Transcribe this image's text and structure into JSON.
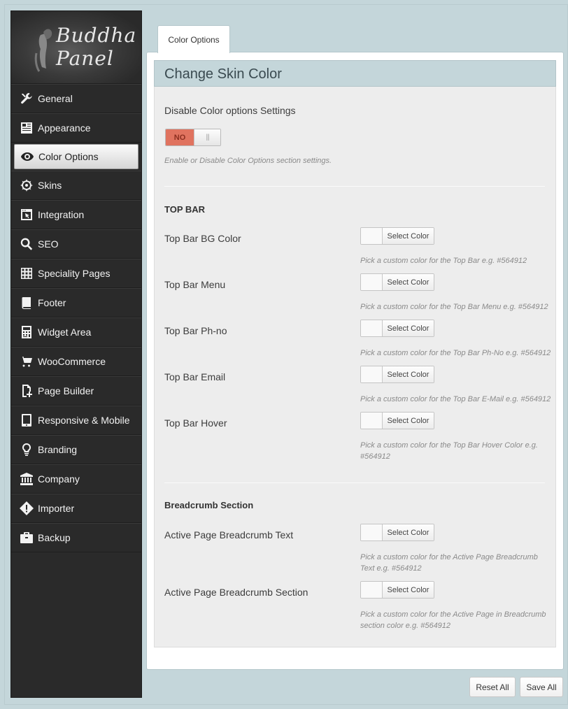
{
  "logo": {
    "line1": "Buddha",
    "line2": "Panel"
  },
  "sidebar": {
    "items": [
      {
        "label": "General",
        "icon": "wrench-icon"
      },
      {
        "label": "Appearance",
        "icon": "newspaper-icon"
      },
      {
        "label": "Color Options",
        "icon": "eye-icon",
        "active": true
      },
      {
        "label": "Skins",
        "icon": "ship-wheel-icon"
      },
      {
        "label": "Integration",
        "icon": "browser-cursor-icon"
      },
      {
        "label": "SEO",
        "icon": "magnifier-icon"
      },
      {
        "label": "Speciality Pages",
        "icon": "grid-icon"
      },
      {
        "label": "Footer",
        "icon": "book-icon"
      },
      {
        "label": "Widget Area",
        "icon": "calculator-icon"
      },
      {
        "label": "WooCommerce",
        "icon": "cart-icon"
      },
      {
        "label": "Page Builder",
        "icon": "file-plus-icon"
      },
      {
        "label": "Responsive & Mobile",
        "icon": "tablet-icon"
      },
      {
        "label": "Branding",
        "icon": "bulb-icon"
      },
      {
        "label": "Company",
        "icon": "bank-icon"
      },
      {
        "label": "Importer",
        "icon": "warning-diamond-icon"
      },
      {
        "label": "Backup",
        "icon": "briefcase-icon"
      }
    ]
  },
  "tab": {
    "label": "Color Options"
  },
  "section": {
    "title": "Change Skin Color"
  },
  "disable": {
    "label": "Disable Color options Settings",
    "toggle_value": "NO",
    "toggle_knob": "|||",
    "desc": "Enable or Disable Color Options section settings."
  },
  "top_bar": {
    "heading": "TOP BAR",
    "fields": [
      {
        "label": "Top Bar BG Color",
        "button": "Select Color",
        "desc": "Pick a custom color for the Top Bar e.g. #564912"
      },
      {
        "label": "Top Bar Menu",
        "button": "Select Color",
        "desc": "Pick a custom color for the Top Bar Menu e.g. #564912"
      },
      {
        "label": "Top Bar Ph-no",
        "button": "Select Color",
        "desc": "Pick a custom color for the Top Bar Ph-No e.g. #564912"
      },
      {
        "label": "Top Bar Email",
        "button": "Select Color",
        "desc": "Pick a custom color for the Top Bar E-Mail e.g. #564912"
      },
      {
        "label": "Top Bar Hover",
        "button": "Select Color",
        "desc1": "Pick a custom color for the Top Bar Hover Color e.g.",
        "desc2": "#564912"
      }
    ]
  },
  "breadcrumb": {
    "heading": "Breadcrumb Section",
    "fields": [
      {
        "label": "Active Page Breadcrumb Text",
        "button": "Select Color",
        "desc1": "Pick a custom color for the Active Page Breadcrumb",
        "desc2": "Text e.g. #564912"
      },
      {
        "label": "Active Page Breadcrumb Section",
        "button": "Select Color",
        "desc1": "Pick a custom color for the Active Page in Breadcrumb",
        "desc2": "section color e.g. #564912"
      }
    ]
  },
  "footer_buttons": {
    "reset": "Reset All",
    "save": "Save All"
  },
  "colors": {
    "background": "#c4d6da",
    "sidebar": "#2a2a2a",
    "toggle_off": "#e0735f"
  }
}
